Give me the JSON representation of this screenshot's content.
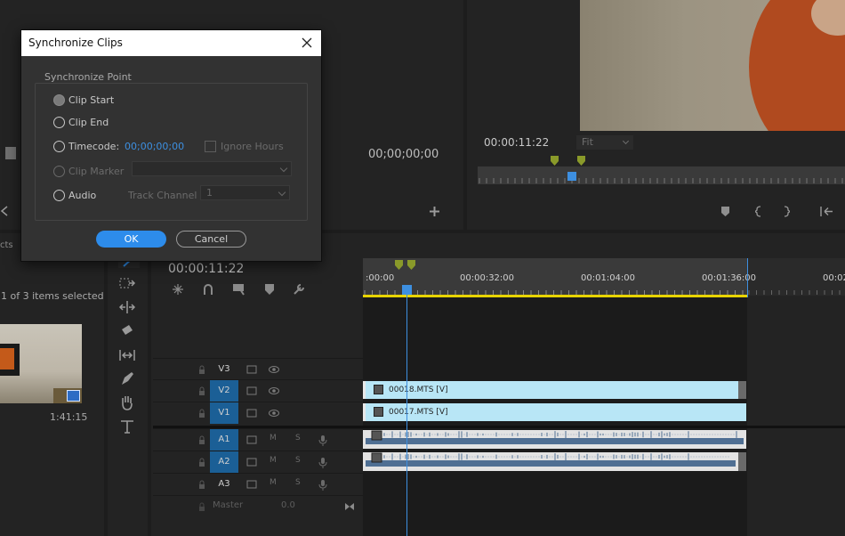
{
  "dialog": {
    "title": "Synchronize Clips",
    "group_title": "Synchronize Point",
    "options": {
      "clip_start": "Clip Start",
      "clip_end": "Clip End",
      "timecode": "Timecode:",
      "clip_marker": "Clip Marker",
      "audio": "Audio"
    },
    "timecode_value": "00;00;00;00",
    "ignore_hours": "Ignore Hours",
    "track_channel_label": "Track Channel",
    "track_channel_value": "1",
    "ok_label": "OK",
    "cancel_label": "Cancel"
  },
  "source_monitor": {
    "timecode": "00;00;00;00"
  },
  "program_monitor": {
    "timecode": "00:00:11:22",
    "zoom": "Fit"
  },
  "project_panel": {
    "tab_partial": "cts",
    "selection_status": "1 of 3 items selected",
    "clip_duration": "1:41:15"
  },
  "timeline": {
    "timecode": "00:00:11:22",
    "ruler_labels": [
      ":00:00",
      "00:00:32:00",
      "00:01:04:00",
      "00:01:36:00",
      "00:02"
    ],
    "tracks": [
      {
        "name": "V3",
        "on": false,
        "kind": "video"
      },
      {
        "name": "V2",
        "on": true,
        "kind": "video"
      },
      {
        "name": "V1",
        "on": true,
        "kind": "video"
      },
      {
        "name": "A1",
        "on": true,
        "kind": "audio"
      },
      {
        "name": "A2",
        "on": true,
        "kind": "audio"
      },
      {
        "name": "A3",
        "on": false,
        "kind": "audio"
      }
    ],
    "master_label": "Master",
    "master_value": "0.0",
    "clips": {
      "v2": "00018.MTS [V]",
      "v1": "00017.MTS [V]"
    },
    "mute_label": "M",
    "solo_label": "S"
  },
  "colors": {
    "accent": "#2d8ceb",
    "track_on": "#1b5f96",
    "clip_video": "#b8e6f6",
    "playhead": "#3d8fe0",
    "marker": "#8a9a2a",
    "work_area": "#e8d400"
  }
}
